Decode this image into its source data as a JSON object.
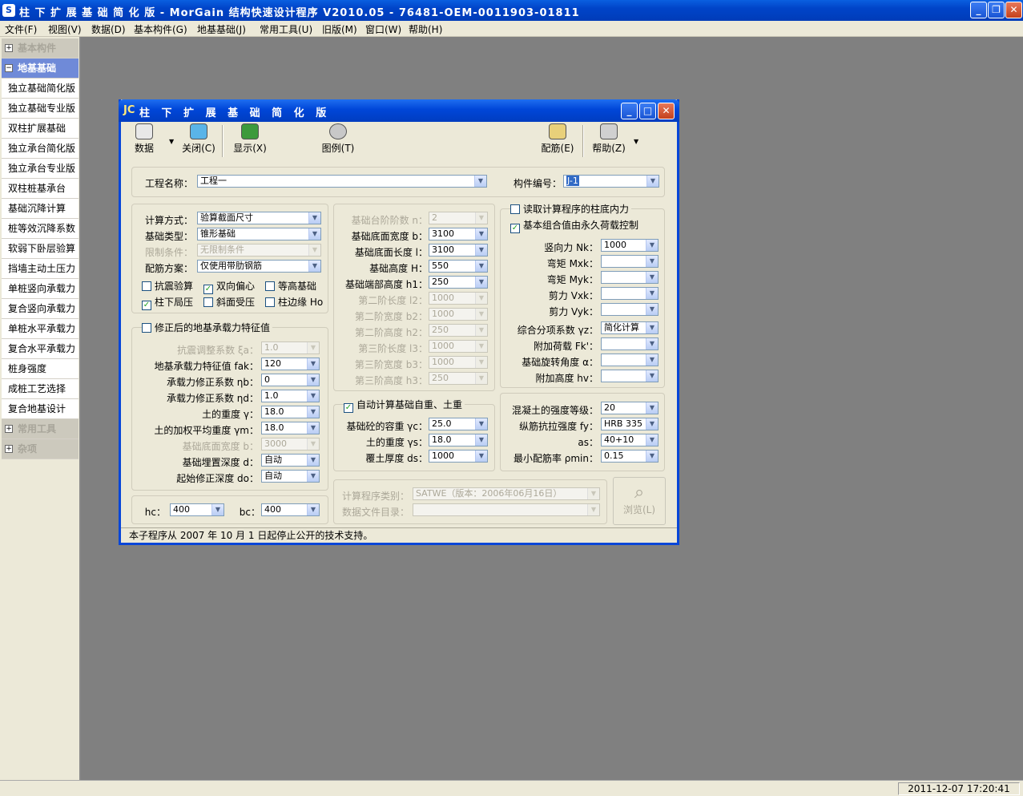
{
  "window": {
    "title": "柱 下 扩 展 基 础 简 化 版 - MorGain 结构快速设计程序 V2010.05 - 76481-OEM-0011903-01811"
  },
  "menu": [
    "文件(F)",
    "视图(V)",
    "数据(D)",
    "基本构件(G)",
    "地基基础(J)",
    "常用工具(U)",
    "旧版(M)",
    "窗口(W)",
    "帮助(H)"
  ],
  "sidebar": {
    "cat1": "基本构件",
    "cat2": "地基基础",
    "items": [
      "独立基础简化版",
      "独立基础专业版",
      "双柱扩展基础",
      "独立承台简化版",
      "独立承台专业版",
      "双柱桩基承台",
      "基础沉降计算",
      "桩等效沉降系数",
      "软弱下卧层验算",
      "挡墙主动土压力",
      "单桩竖向承载力",
      "复合竖向承载力",
      "单桩水平承载力",
      "复合水平承载力",
      "桩身强度",
      "成桩工艺选择",
      "复合地基设计"
    ],
    "cat3": "常用工具",
    "cat4": "杂项"
  },
  "status": {
    "datetime": "2011-12-07 17:20:41"
  },
  "dialog": {
    "title_prefix": "JC",
    "title": "柱 下 扩 展 基 础 简 化 版",
    "toolbar": {
      "data": "数据",
      "close": "关闭(C)",
      "show": "显示(X)",
      "legend": "图例(T)",
      "rebar": "配筋(E)",
      "help": "帮助(Z)"
    },
    "project_label": "工程名称：",
    "project_value": "工程一",
    "member_label": "构件编号：",
    "member_value": "J-1",
    "calc_label": "计算方式：",
    "calc_value": "验算截面尺寸",
    "type_label": "基础类型：",
    "type_value": "锥形基础",
    "limit_label": "限制条件：",
    "limit_value": "无限制条件",
    "rebar_label": "配筋方案：",
    "rebar_value": "仅使用带肋钢筋",
    "cb_seismic": "抗震验算",
    "cb_biaxial": "双向偏心",
    "cb_equal": "等高基础",
    "cb_local": "柱下局压",
    "cb_slope": "斜面受压",
    "cb_edge": "柱边缘 Ho",
    "cb_corrected": "修正后的地基承载力特征值",
    "seis_label": "抗震调整系数 ξa：",
    "seis_value": "1.0",
    "fak_label": "地基承载力特征值 fak：",
    "fak_value": "120",
    "nb_label": "承载力修正系数 ηb：",
    "nb_value": "0",
    "nd_label": "承载力修正系数 ηd：",
    "nd_value": "1.0",
    "gamma_label": "土的重度 γ：",
    "gamma_value": "18.0",
    "gm_label": "土的加权平均重度 γm：",
    "gm_value": "18.0",
    "bw_label": "基础底面宽度 b：",
    "bw_value": "3000",
    "d_label": "基础埋置深度 d：",
    "d_value": "自动",
    "d0_label": "起始修正深度 do：",
    "d0_value": "自动",
    "hc_label": "hc：",
    "hc_value": "400",
    "bc_label": "bc：",
    "bc_value": "400",
    "n_label": "基础台阶阶数 n：",
    "n_value": "2",
    "b_label": "基础底面宽度 b：",
    "b_value": "3100",
    "l_label": "基础底面长度 l：",
    "l_value": "3100",
    "h_label": "基础高度 H：",
    "h_value": "550",
    "h1_label": "基础端部高度 h1：",
    "h1_value": "250",
    "l2_label": "第二阶长度 l2：",
    "l2_value": "1000",
    "b2_label": "第二阶宽度 b2：",
    "b2_value": "1000",
    "h2_label": "第二阶高度 h2：",
    "h2_value": "250",
    "l3_label": "第三阶长度 l3：",
    "l3_value": "1000",
    "b3_label": "第三阶宽度 b3：",
    "b3_value": "1000",
    "h3_label": "第三阶高度 h3：",
    "h3_value": "250",
    "cb_auto": "自动计算基础自重、土重",
    "gc_label": "基础砼的容重 γc：",
    "gc_value": "25.0",
    "gs_label": "土的重度 γs：",
    "gs_value": "18.0",
    "ds_label": "覆土厚度 ds：",
    "ds_value": "1000",
    "prog_label": "计算程序类别：",
    "prog_value": "SATWE（版本：2006年06月16日）",
    "dir_label": "数据文件目录：",
    "dir_value": "",
    "browse": "浏览(L)",
    "cb_read": "读取计算程序的柱底内力",
    "cb_combo": "基本组合值由永久荷载控制",
    "nk_label": "竖向力 Nk：",
    "nk_value": "1000",
    "mxk_label": "弯矩 Mxk：",
    "myk_label": "弯矩 Myk：",
    "vxk_label": "剪力 Vxk：",
    "vyk_label": "剪力 Vyk：",
    "gz_label": "综合分项系数 γz：",
    "gz_value": "简化计算",
    "fk_label": "附加荷载 Fk'：",
    "a_label": "基础旋转角度 α：",
    "hv_label": "附加高度 hv：",
    "conc_label": "混凝土的强度等级：",
    "conc_value": "20",
    "fy_label": "纵筋抗拉强度 fy：",
    "fy_value": "HRB 335",
    "as_label": "as：",
    "as_value": "40+10",
    "pmin_label": "最小配筋率 ρmin：",
    "pmin_value": "0.15",
    "status": "本子程序从 2007 年 10 月 1 日起停止公开的技术支持。"
  }
}
